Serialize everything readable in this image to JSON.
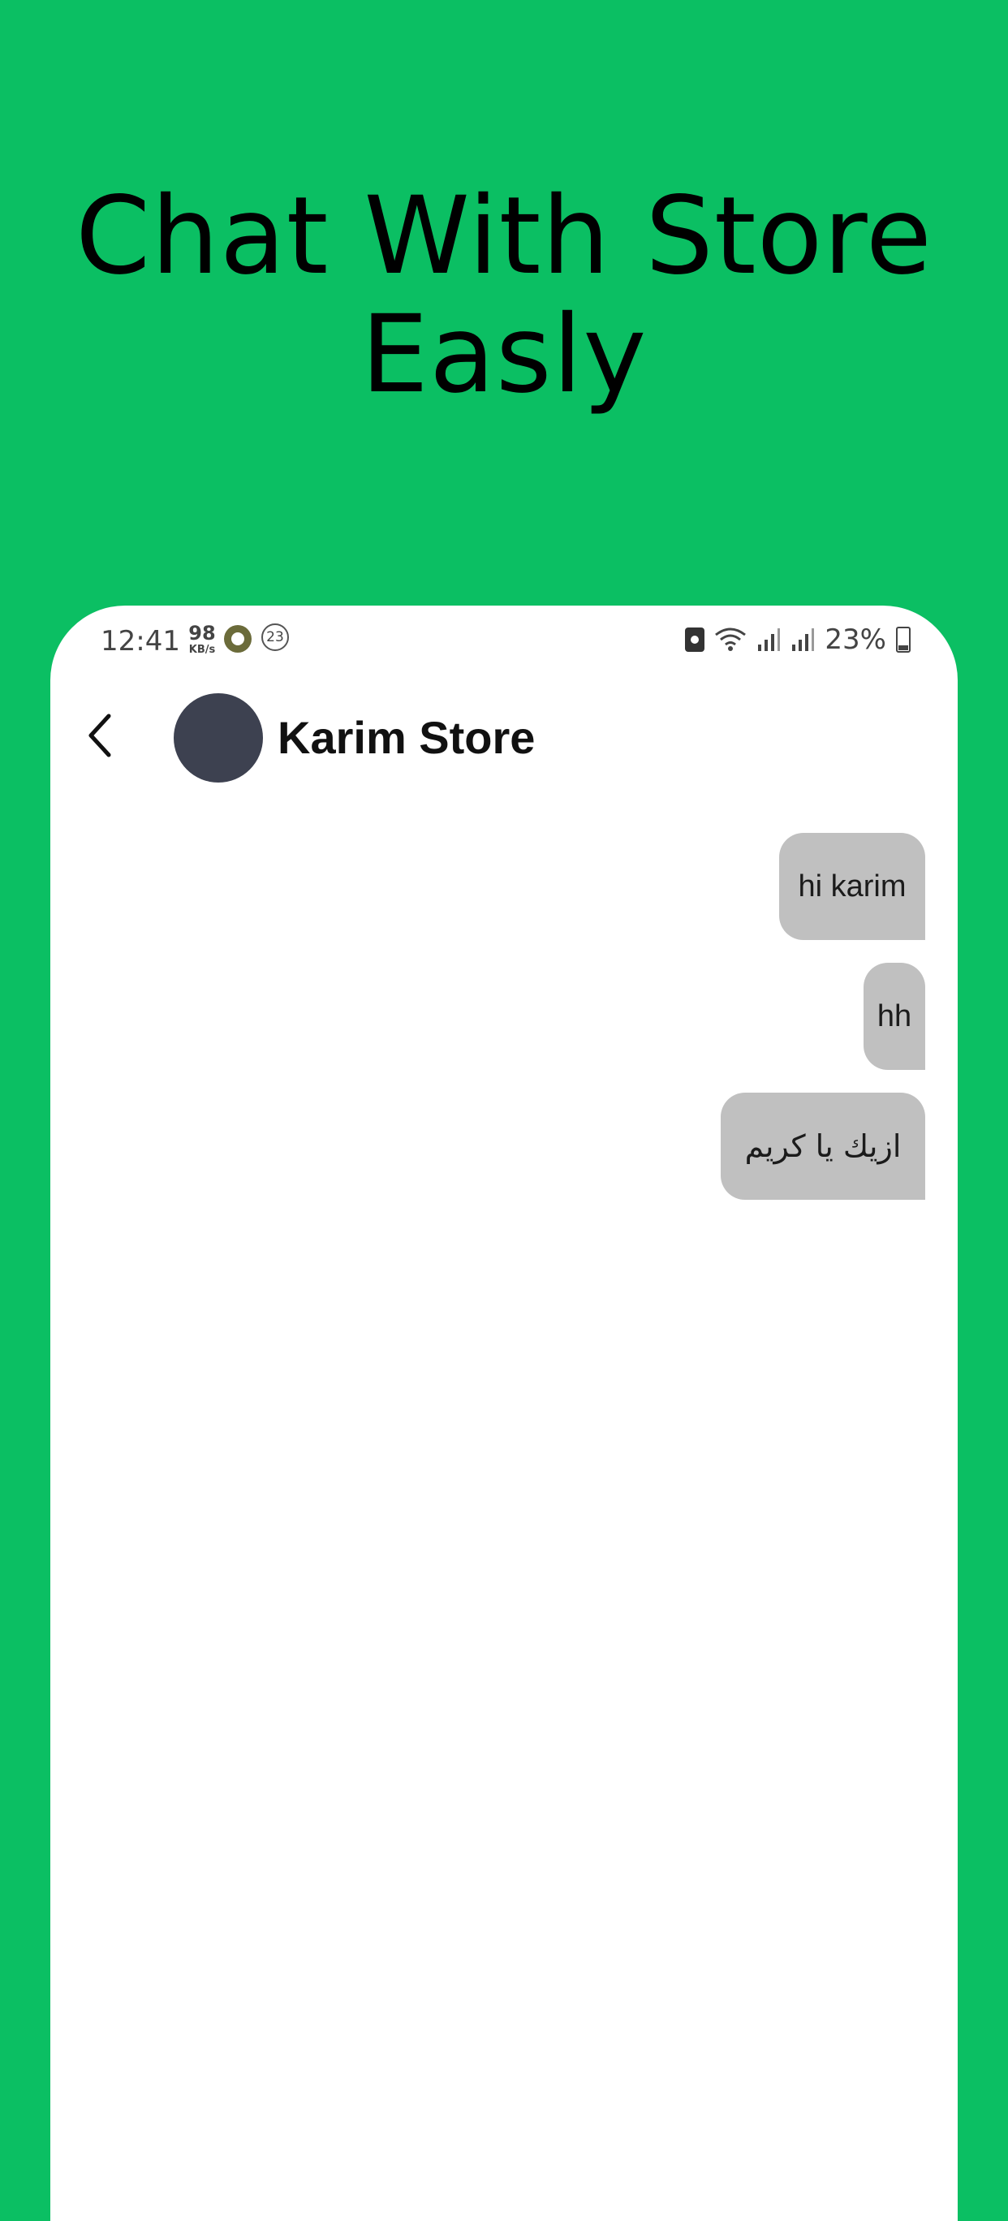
{
  "headline": {
    "line1": "Chat With Store",
    "line2": "Easly"
  },
  "status_bar": {
    "time": "12:41",
    "net_speed_value": "98",
    "net_speed_unit": "KB/s",
    "notification_count": "23",
    "battery_percent": "23%",
    "battery_level": 0.23
  },
  "header": {
    "back_icon": "chevron-left-icon",
    "store_name": "Karim Store"
  },
  "messages": [
    {
      "text": "hi karim"
    },
    {
      "text": "hh"
    },
    {
      "text": "ازيك يا كريم"
    }
  ],
  "colors": {
    "background": "#0bbf63",
    "bubble": "#c0c0c0",
    "avatar": "#3d4150"
  }
}
